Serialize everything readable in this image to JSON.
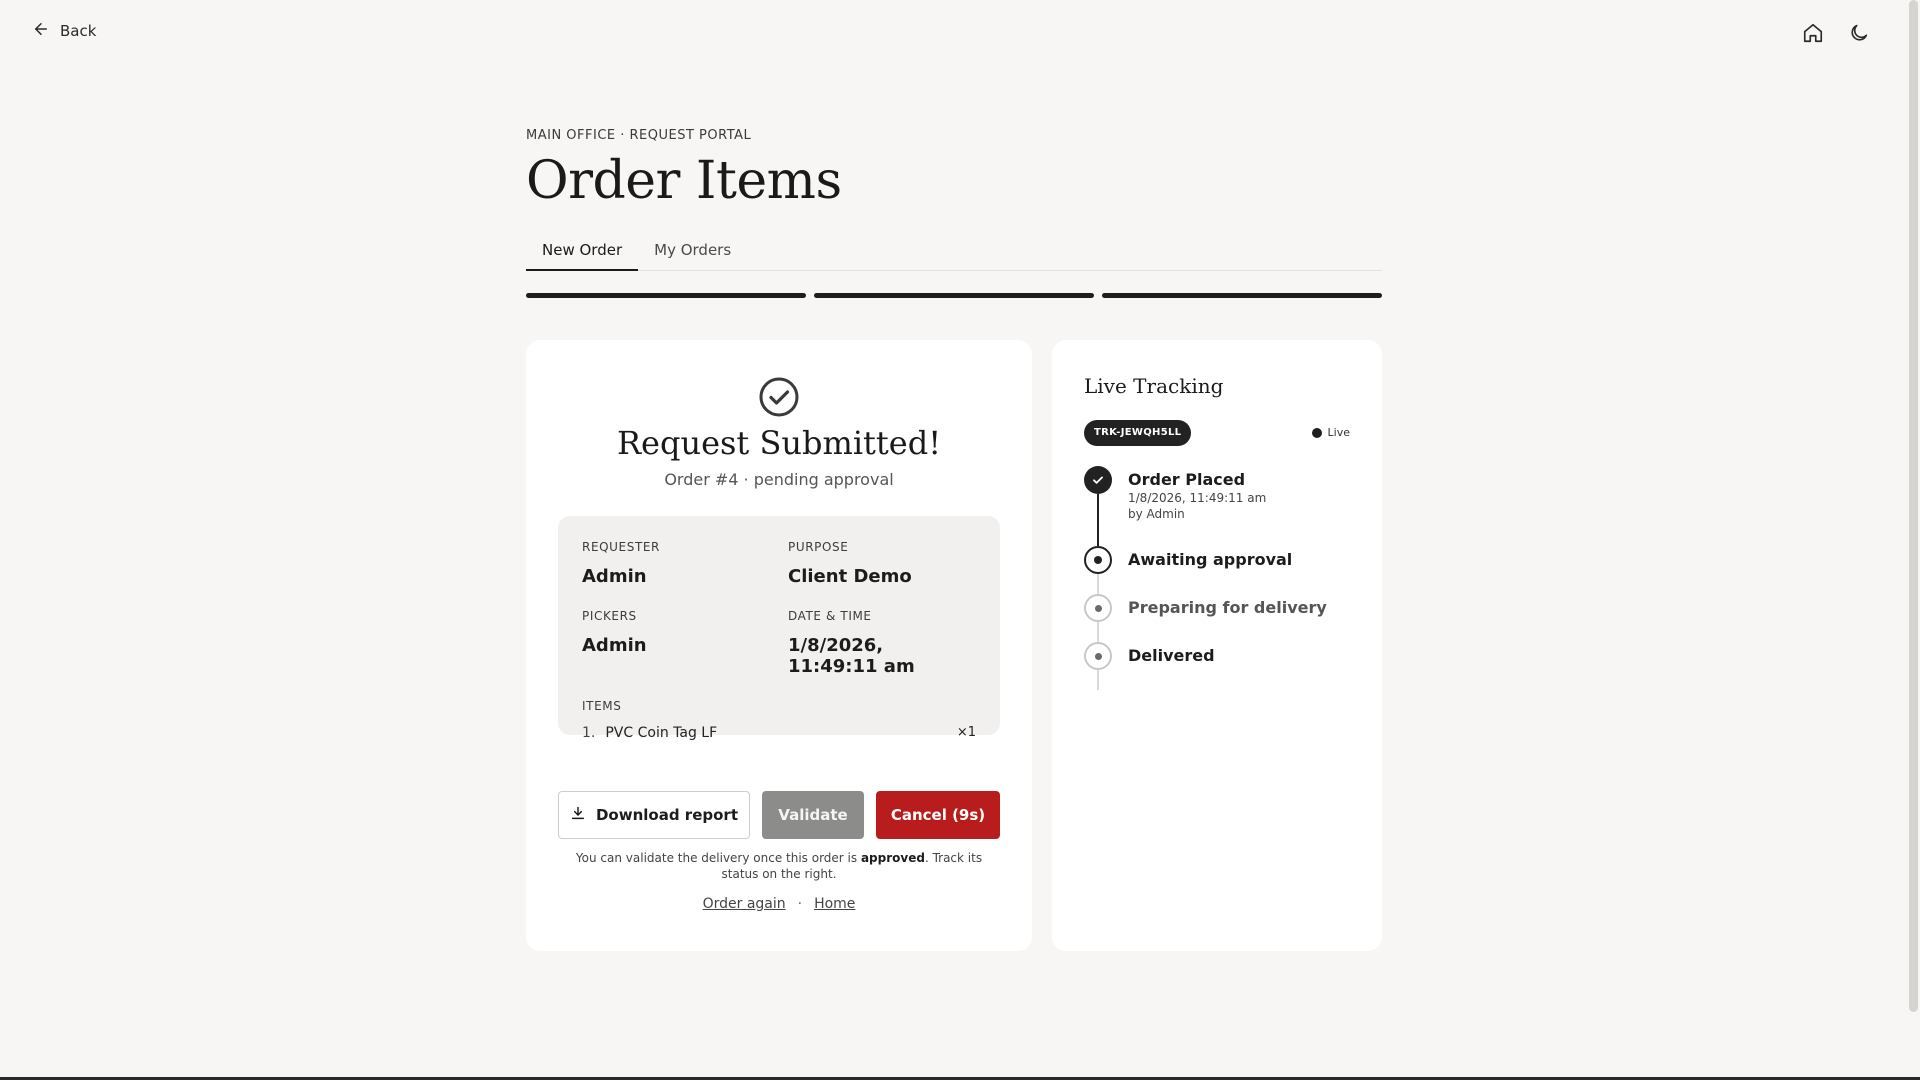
{
  "nav": {
    "back_label": "Back",
    "icons": [
      "home-icon",
      "moon-icon"
    ]
  },
  "header": {
    "eyebrow": "MAIN OFFICE · REQUEST PORTAL",
    "title": "Order Items",
    "tabs": [
      {
        "label": "New Order",
        "active": true
      },
      {
        "label": "My Orders",
        "active": false
      }
    ],
    "progress_steps_completed": 3,
    "progress_steps_total": 3
  },
  "confirmation": {
    "icon": "check-circle-icon",
    "title": "Request Submitted!",
    "subtitle": "Order #4 · pending approval",
    "details": {
      "requester_label": "REQUESTER",
      "requester_value": "Admin",
      "purpose_label": "PURPOSE",
      "purpose_value": "Client Demo",
      "pickers_label": "PICKERS",
      "pickers_value": "Admin",
      "datetime_label": "DATE & TIME",
      "datetime_value": "1/8/2026, 11:49:11 am",
      "items_label": "ITEMS",
      "items": [
        {
          "index": "1.",
          "name": "PVC Coin Tag LF",
          "qty": "×1"
        }
      ]
    },
    "buttons": {
      "download": "Download report",
      "validate": "Validate",
      "cancel": "Cancel (9s)"
    },
    "note_before": "You can validate the delivery once this order is ",
    "note_bold": "approved",
    "note_after": ". Track its status on the right.",
    "links": {
      "order_again": "Order again",
      "separator": "·",
      "home": "Home"
    }
  },
  "tracking": {
    "title": "Live Tracking",
    "tracking_id": "TRK-JEWQH5LL",
    "live_label": "Live",
    "steps": [
      {
        "label": "Order Placed",
        "status": "done",
        "time": "1/8/2026, 11:49:11 am",
        "by": "by Admin"
      },
      {
        "label": "Awaiting approval",
        "status": "current"
      },
      {
        "label": "Preparing for delivery",
        "status": "pending"
      },
      {
        "label": "Delivered",
        "status": "pending"
      }
    ]
  },
  "colors": {
    "background": "#f7f6f4",
    "card": "#ffffff",
    "accent_dark": "#1e1e1e",
    "cancel_red": "#b91c1c",
    "validate_disabled": "#8c8d8a"
  }
}
